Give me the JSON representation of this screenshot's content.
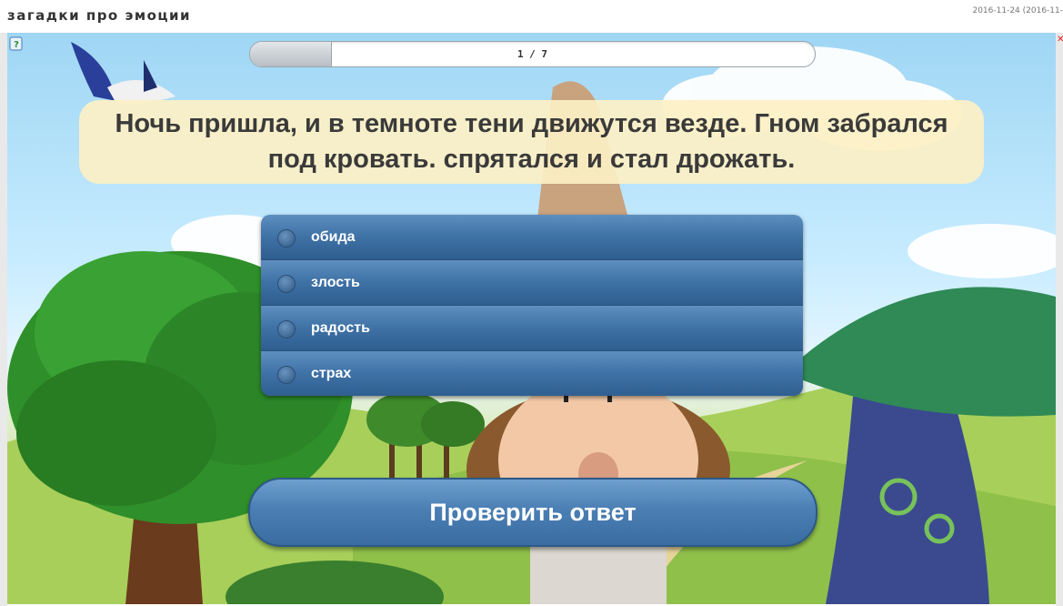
{
  "header": {
    "title": "загадки про эмоции",
    "timestamp": "2016-11-24 (2016-11-"
  },
  "quiz": {
    "progress_text": "1 / 7",
    "progress_fraction": 0.143,
    "question": "Ночь пришла, и в темноте тени движутся везде. Гном забрался под кровать. спрятался и стал дрожать.",
    "answers": [
      {
        "label": "обида"
      },
      {
        "label": "злость"
      },
      {
        "label": "радость"
      },
      {
        "label": "страх"
      }
    ],
    "check_button_label": "Проверить ответ"
  },
  "icons": {
    "help": "help-icon",
    "close": "close-icon"
  },
  "colors": {
    "answer_blue": "#3f72a6",
    "question_bg": "#fcf0c4",
    "close_red": "#e02020"
  }
}
